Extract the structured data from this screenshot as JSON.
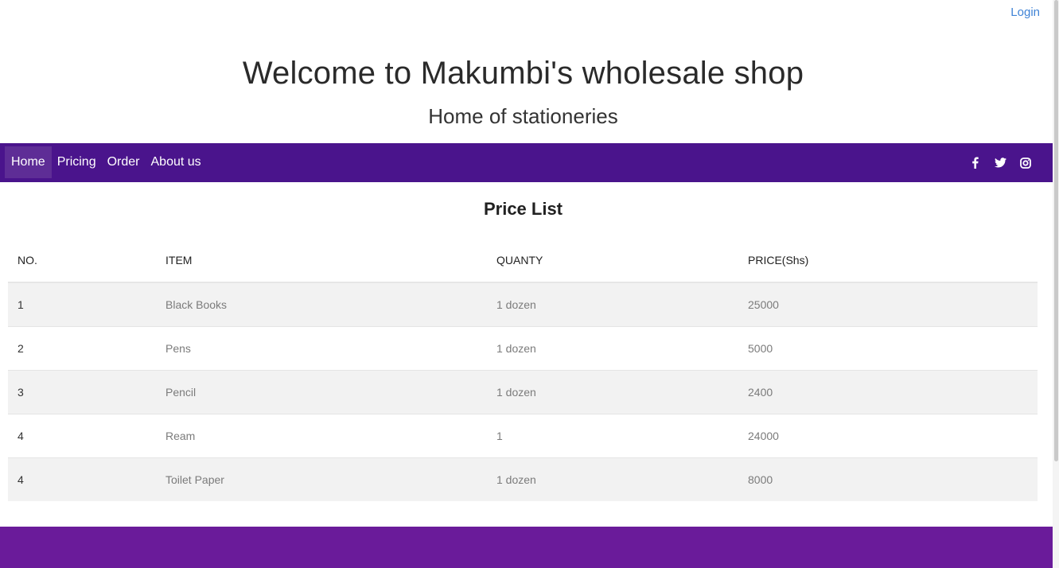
{
  "header": {
    "login_label": "Login",
    "title": "Welcome to Makumbi's wholesale shop",
    "subtitle": "Home of stationeries"
  },
  "navbar": {
    "items": [
      {
        "label": "Home",
        "active": true
      },
      {
        "label": "Pricing",
        "active": false
      },
      {
        "label": "Order",
        "active": false
      },
      {
        "label": "About us",
        "active": false
      }
    ],
    "social_icons": [
      "facebook-icon",
      "twitter-icon",
      "instagram-icon"
    ]
  },
  "price_list": {
    "title": "Price List",
    "columns": [
      "NO.",
      "ITEM",
      "QUANTY",
      "PRICE(Shs)"
    ],
    "rows": [
      {
        "no": "1",
        "item": "Black Books",
        "quantity": "1 dozen",
        "price": "25000"
      },
      {
        "no": "2",
        "item": "Pens",
        "quantity": "1 dozen",
        "price": "5000"
      },
      {
        "no": "3",
        "item": "Pencil",
        "quantity": "1 dozen",
        "price": "2400"
      },
      {
        "no": "4",
        "item": "Ream",
        "quantity": "1",
        "price": "24000"
      },
      {
        "no": "4",
        "item": "Toilet Paper",
        "quantity": "1 dozen",
        "price": "8000"
      }
    ]
  },
  "colors": {
    "navbar": "#4a148c",
    "navbar_active": "#5e2d96",
    "footer": "#6a1b9a",
    "link": "#3f83d6",
    "row_stripe": "#f2f2f2"
  }
}
